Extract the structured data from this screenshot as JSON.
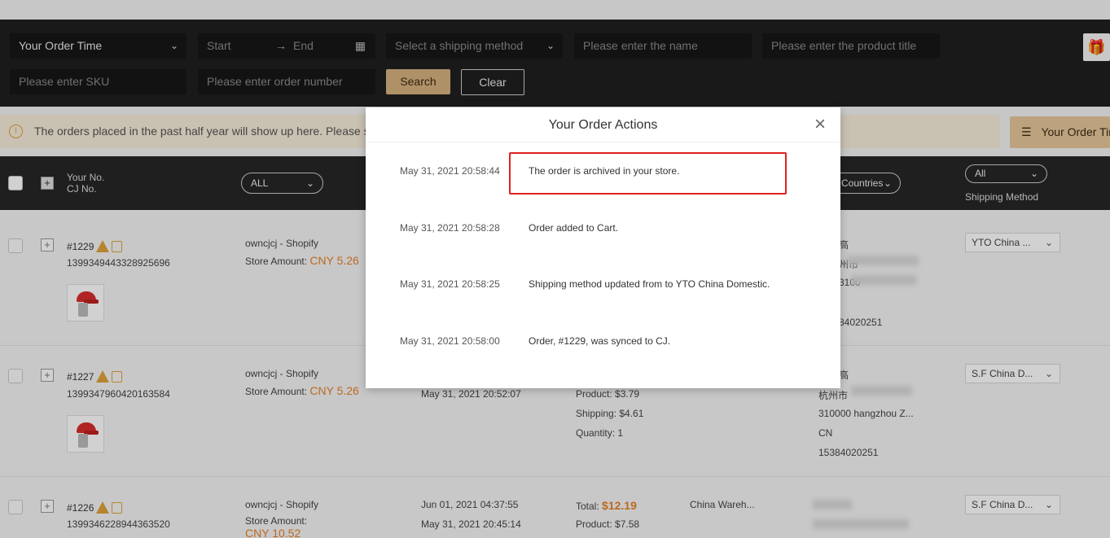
{
  "filters": {
    "order_time": "Your Order Time",
    "start_placeholder": "Start",
    "end_placeholder": "End",
    "shipping_placeholder": "Select a shipping method",
    "name_placeholder": "Please enter the name",
    "product_title_placeholder": "Please enter the product title",
    "sku_placeholder": "Please enter SKU",
    "order_number_placeholder": "Please enter order number",
    "search_label": "Search",
    "clear_label": "Clear"
  },
  "notice": {
    "text": "The orders placed in the past half year will show up here. Please se",
    "sort_label": "Your Order Tim"
  },
  "table_header": {
    "your_no": "Your No.",
    "cj_no": "CJ No.",
    "store_filter": "ALL",
    "countries_filter": "Countries",
    "shipping_filter": "All",
    "shipping_method": "Shipping Method"
  },
  "rows": [
    {
      "order": "#1229",
      "cj_no": "1399349443328925696",
      "store": "owncjcj - Shopify",
      "amount_label": "Store Amount:",
      "amount": "CNY 5.26",
      "addr_name": "高",
      "addr_city": "州市",
      "addr_zip": "3100",
      "addr_phone": "84020251",
      "shipping": "YTO China ..."
    },
    {
      "order": "#1227",
      "cj_no": "1399347960420163584",
      "store": "owncjcj - Shopify",
      "amount_label": "Store Amount:",
      "amount": "CNY 5.26",
      "date": "May 31, 2021 20:52:07",
      "product": "Product: $3.79",
      "ship_cost": "Shipping: $4.61",
      "quantity": "Quantity: 1",
      "addr_name": "高",
      "addr_city": "杭州市",
      "addr_zip": "310000 hangzhou Z...",
      "addr_country": "CN",
      "addr_phone": "15384020251",
      "shipping": "S.F China D..."
    },
    {
      "order": "#1226",
      "cj_no": "1399346228944363520",
      "store": "owncjcj - Shopify",
      "amount_label": "Store Amount:",
      "amount": "CNY 10.52",
      "date1": "Jun 01, 2021 04:37:55",
      "date2": "May 31, 2021 20:45:14",
      "total_label": "Total:",
      "total": "$12.19",
      "product": "Product: $7.58",
      "warehouse": "China Wareh...",
      "shipping": "S.F China D..."
    }
  ],
  "modal": {
    "title": "Your Order Actions",
    "actions": [
      {
        "time": "May 31, 2021 20:58:44",
        "text": "The order is archived in your store."
      },
      {
        "time": "May 31, 2021 20:58:28",
        "text": "Order added to Cart."
      },
      {
        "time": "May 31, 2021 20:58:25",
        "text": "Shipping method updated from to YTO China Domestic."
      },
      {
        "time": "May 31, 2021 20:58:00",
        "text": "Order, #1229, was synced to CJ."
      }
    ]
  }
}
